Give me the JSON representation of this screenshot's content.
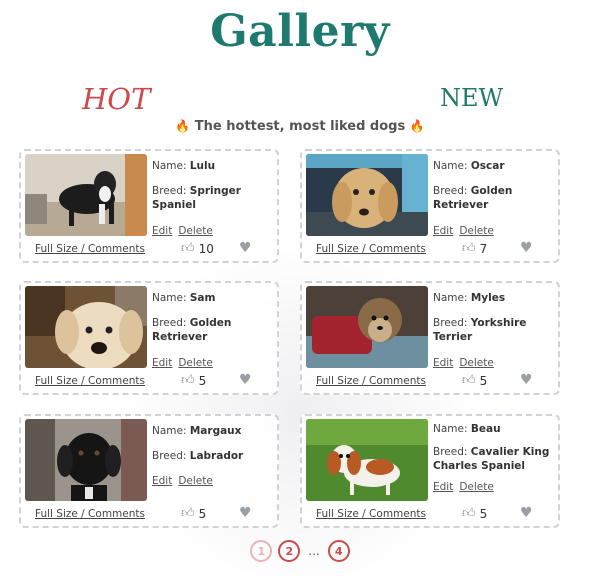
{
  "title": "Gallery",
  "tabs": {
    "hot": "HOT",
    "new": "NEW"
  },
  "subtitle": "The hottest, most liked dogs",
  "labels": {
    "name": "Name:",
    "breed": "Breed:",
    "edit": "Edit",
    "delete": "Delete",
    "full_size": "Full Size / Comments"
  },
  "cards": [
    {
      "name": "Lulu",
      "breed": "Springer Spaniel",
      "likes": "10"
    },
    {
      "name": "Oscar",
      "breed": "Golden Retriever",
      "likes": "7"
    },
    {
      "name": "Sam",
      "breed": "Golden Retriever",
      "likes": "5"
    },
    {
      "name": "Myles",
      "breed": "Yorkshire Terrier",
      "likes": "5"
    },
    {
      "name": "Margaux",
      "breed": "Labrador",
      "likes": "5"
    },
    {
      "name": "Beau",
      "breed": "Cavalier King Charles Spaniel",
      "likes": "5"
    }
  ],
  "pagination": {
    "pages": [
      "1",
      "2",
      "4"
    ],
    "ellipsis": "...",
    "current": "1"
  },
  "colors": {
    "title": "#1e7a6e",
    "hot": "#cc4a4a",
    "new": "#1e7a6e",
    "border": "#cfd2d6"
  }
}
